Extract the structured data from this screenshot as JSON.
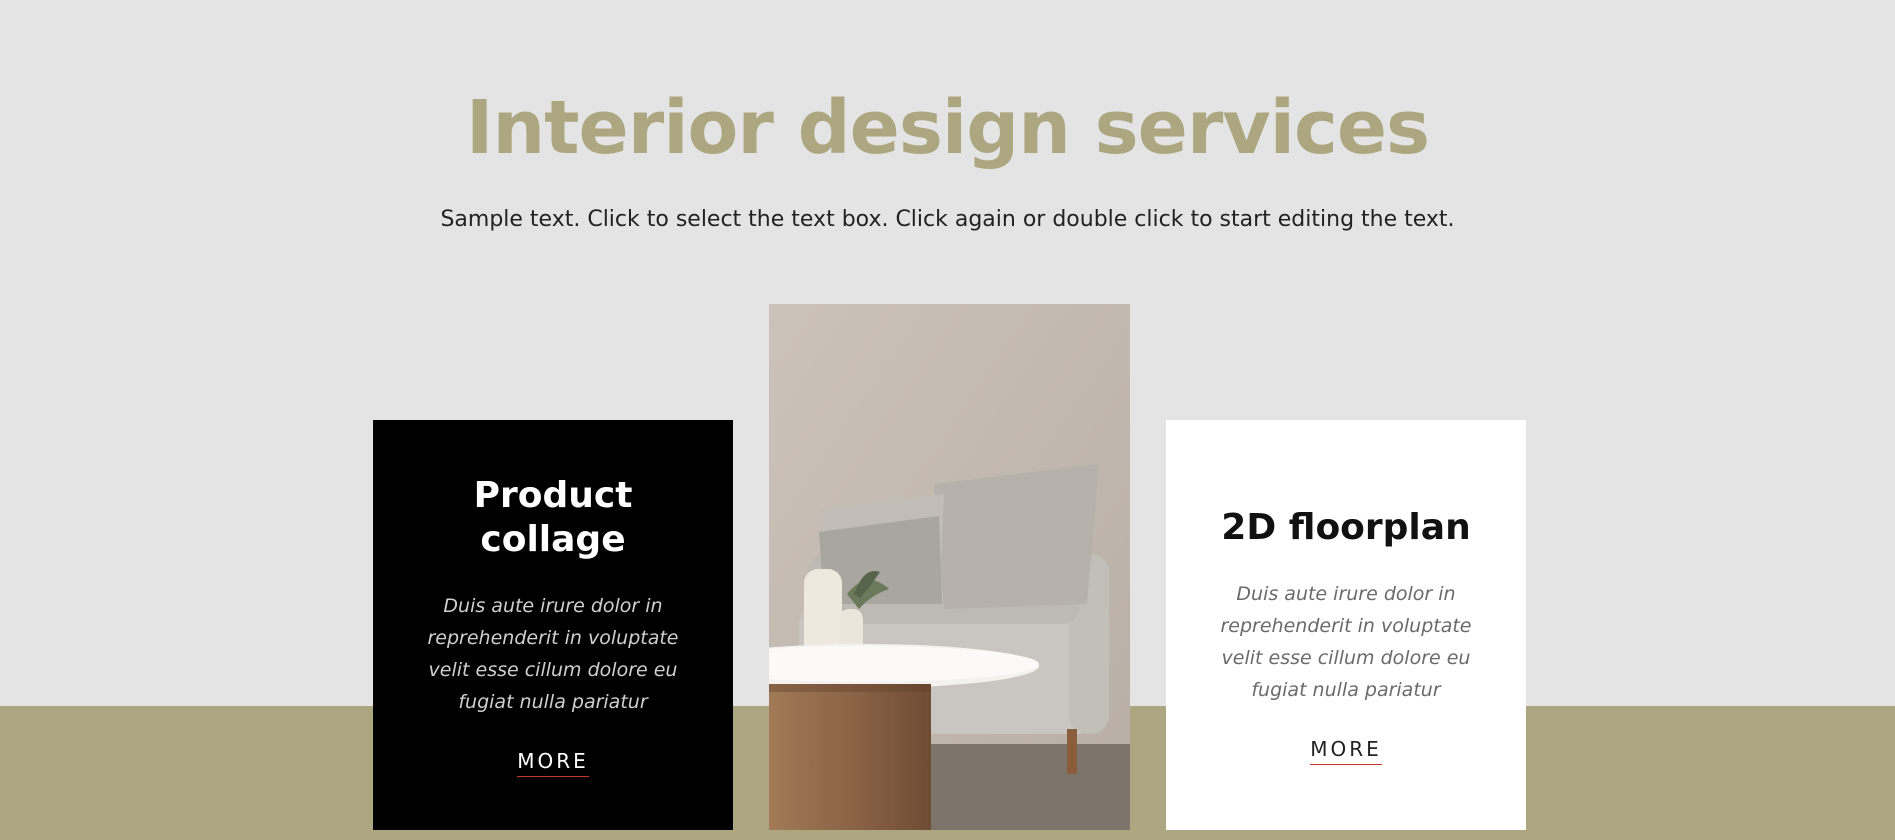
{
  "hero": {
    "title": "Interior design services",
    "subtitle": "Sample text. Click to select the text box. Click again or double click to start editing the text."
  },
  "cards": [
    {
      "title": "Product collage",
      "text": "Duis aute irure dolor in reprehenderit in voluptate velit esse cillum dolore eu fugiat nulla pariatur",
      "button": "MORE"
    },
    {
      "title": "2D floorplan",
      "text": "Duis aute irure dolor in reprehenderit in voluptate velit esse cillum dolore eu fugiat nulla pariatur",
      "button": "MORE"
    }
  ],
  "image": {
    "subject": "sofa-with-side-table-photo"
  },
  "colors": {
    "background": "#e4e4e4",
    "accent": "#aca681",
    "card_dark": "#000000",
    "card_light": "#ffffff",
    "link_underline": "#c0392b"
  }
}
